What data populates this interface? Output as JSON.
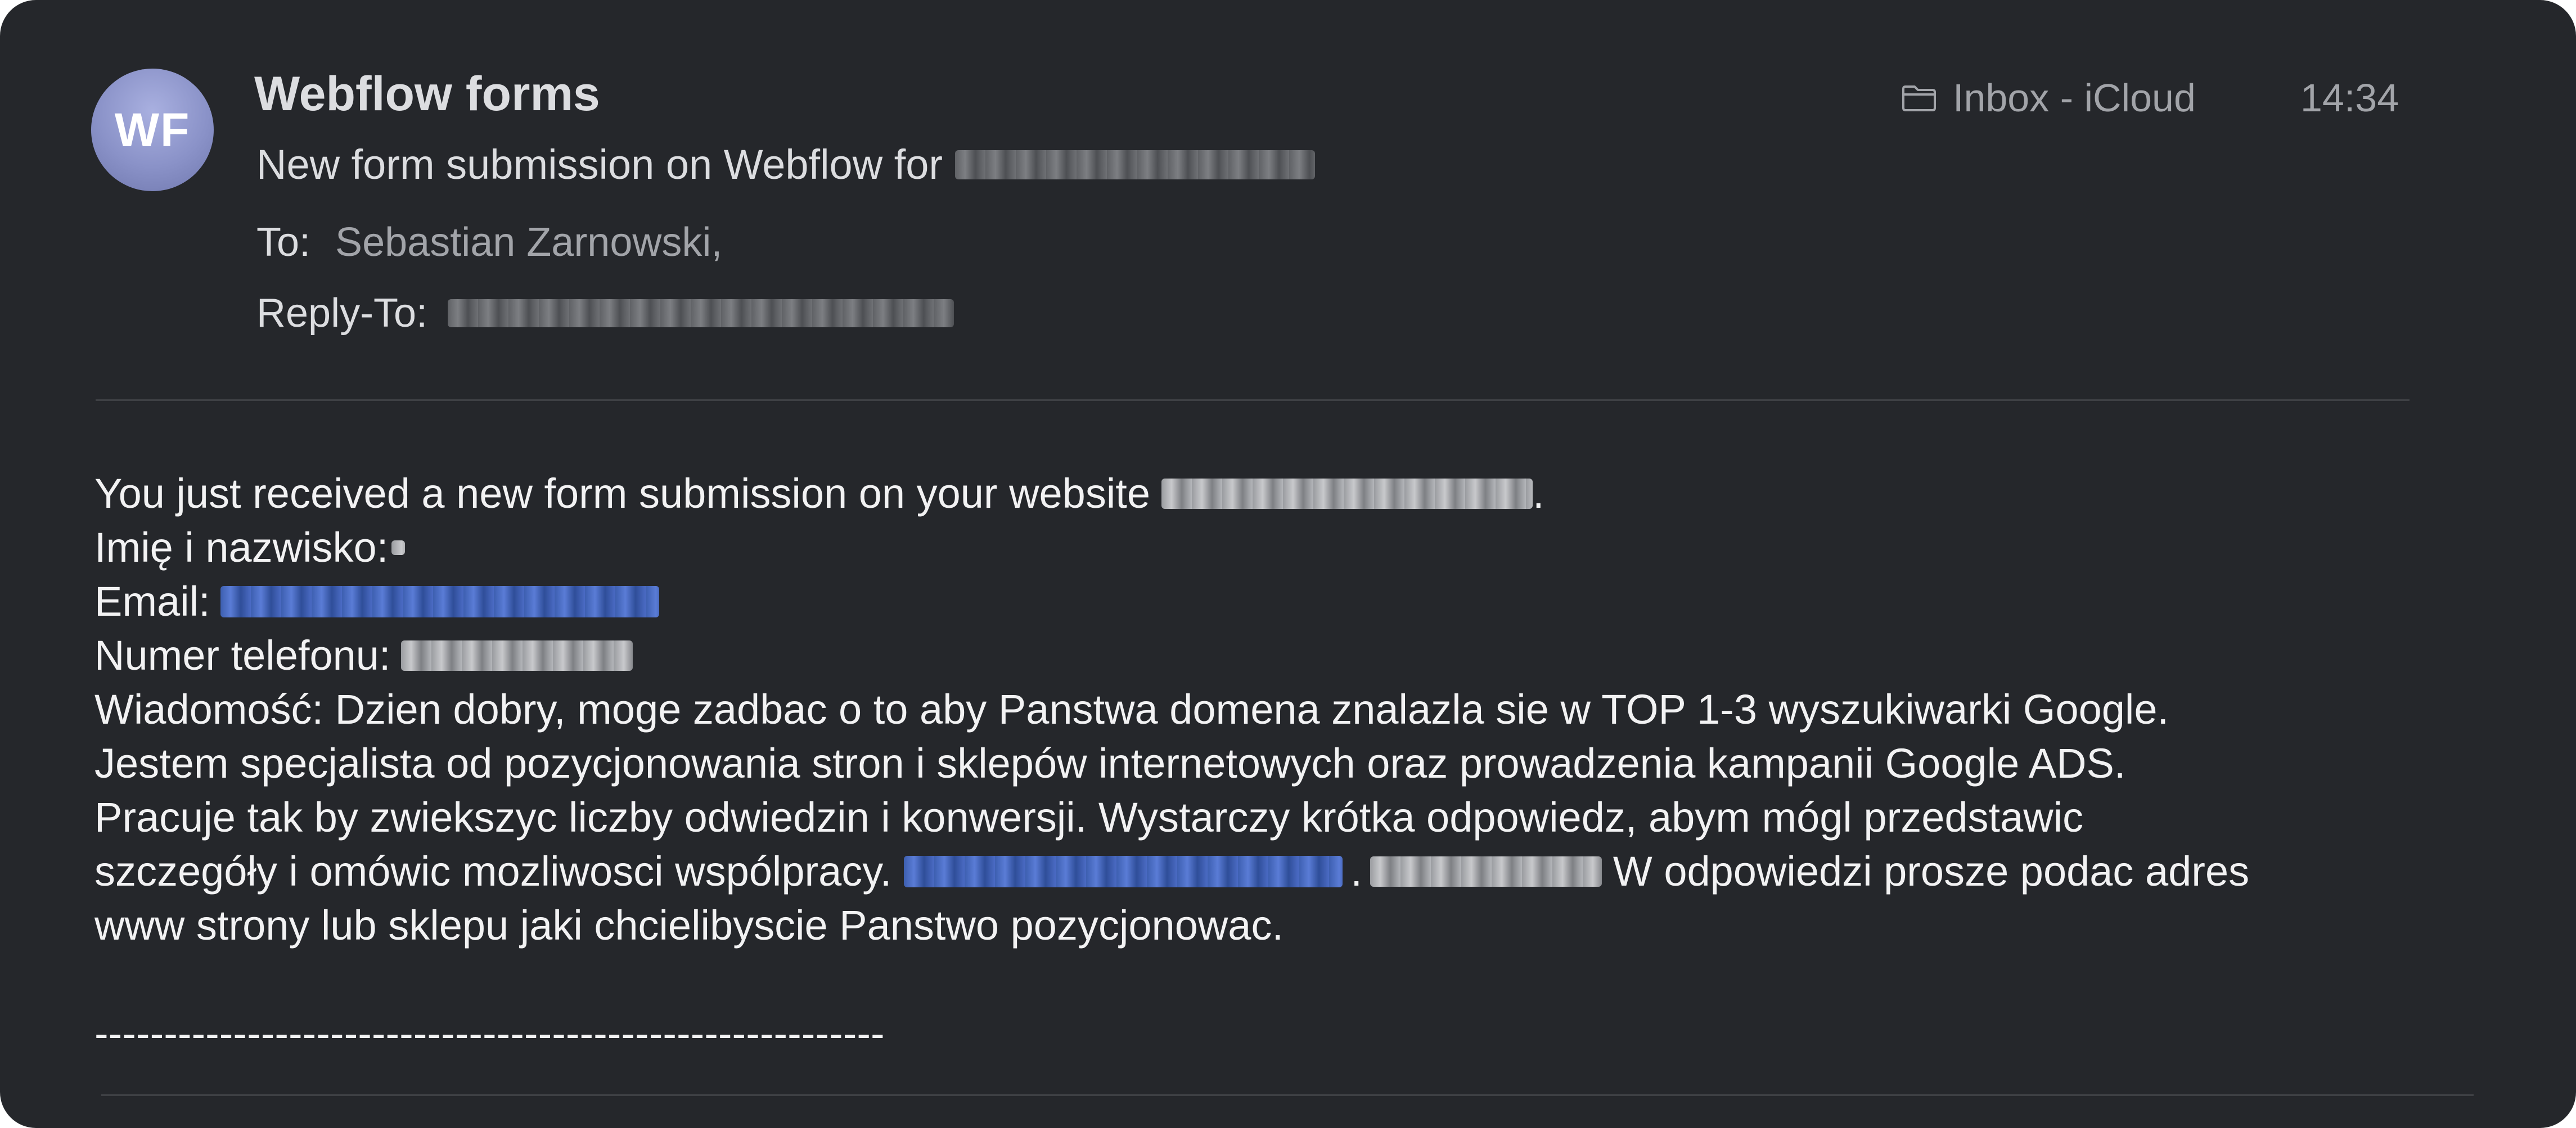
{
  "header": {
    "avatar_initials": "WF",
    "avatar_color": "#8a92c8",
    "sender": "Webflow forms",
    "subject_prefix": "New form submission on Webflow for",
    "to_label": "To:",
    "to_value": "Sebastian Zarnowski,",
    "reply_to_label": "Reply-To:",
    "mailbox_icon": "folder-icon",
    "mailbox": "Inbox - iCloud",
    "time": "14:34"
  },
  "body": {
    "intro": "You just received a new form submission on your website",
    "intro_end": ".",
    "name_label": "Imię i nazwisko:",
    "email_label": "Email:",
    "phone_label": "Numer telefonu:",
    "message_line1": "Wiadomość: Dzien dobry, moge zadbac o to aby Panstwa domena znalazla sie w TOP 1-3 wyszukiwarki Google.",
    "message_line2": "Jestem specjalista od pozycjonowania stron i sklepów internetowych oraz prowadzenia kampanii Google ADS.",
    "message_line3": "Pracuje tak by zwiekszyc liczby odwiedzin i konwersji. Wystarczy krótka odpowiedz, abym mógl przedstawic",
    "message_line4_start": "szczegóły i omówic mozliwosci wspólpracy.",
    "message_line4_sep": ".",
    "message_line4_end": "W odpowiedzi prosze podac adres",
    "message_line5": "www strony lub sklepu jaki chcielibyscie Panstwo pozycjonowac.",
    "separator": "---------------------------------------------------------"
  },
  "colors": {
    "background": "#25272b",
    "text_primary": "#f2f2f3",
    "text_secondary": "#a2a4a9",
    "link_blue": "#4b6bc4"
  }
}
